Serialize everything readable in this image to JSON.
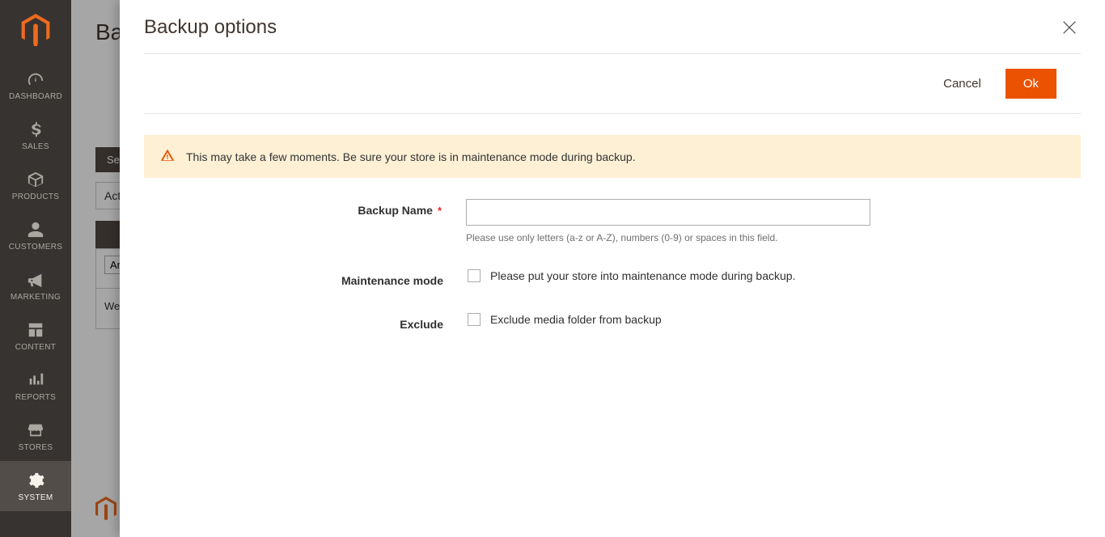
{
  "sidebar": {
    "items": [
      {
        "label": "DASHBOARD"
      },
      {
        "label": "SALES"
      },
      {
        "label": "PRODUCTS"
      },
      {
        "label": "CUSTOMERS"
      },
      {
        "label": "MARKETING"
      },
      {
        "label": "CONTENT"
      },
      {
        "label": "REPORTS"
      },
      {
        "label": "STORES"
      },
      {
        "label": "SYSTEM"
      }
    ]
  },
  "page": {
    "title": "Backups",
    "search_btn": "Search",
    "actions_label": "Actions",
    "filter_any": "Any",
    "data_row": "We"
  },
  "modal": {
    "title": "Backup options",
    "cancel_label": "Cancel",
    "ok_label": "Ok",
    "notice": "This may take a few moments. Be sure your store is in maintenance mode during backup.",
    "backup_name_label": "Backup Name",
    "backup_name_value": "",
    "backup_name_hint": "Please use only letters (a-z or A-Z), numbers (0-9) or spaces in this field.",
    "maintenance_label": "Maintenance mode",
    "maintenance_checkbox_label": "Please put your store into maintenance mode during backup.",
    "exclude_label": "Exclude",
    "exclude_checkbox_label": "Exclude media folder from backup"
  }
}
